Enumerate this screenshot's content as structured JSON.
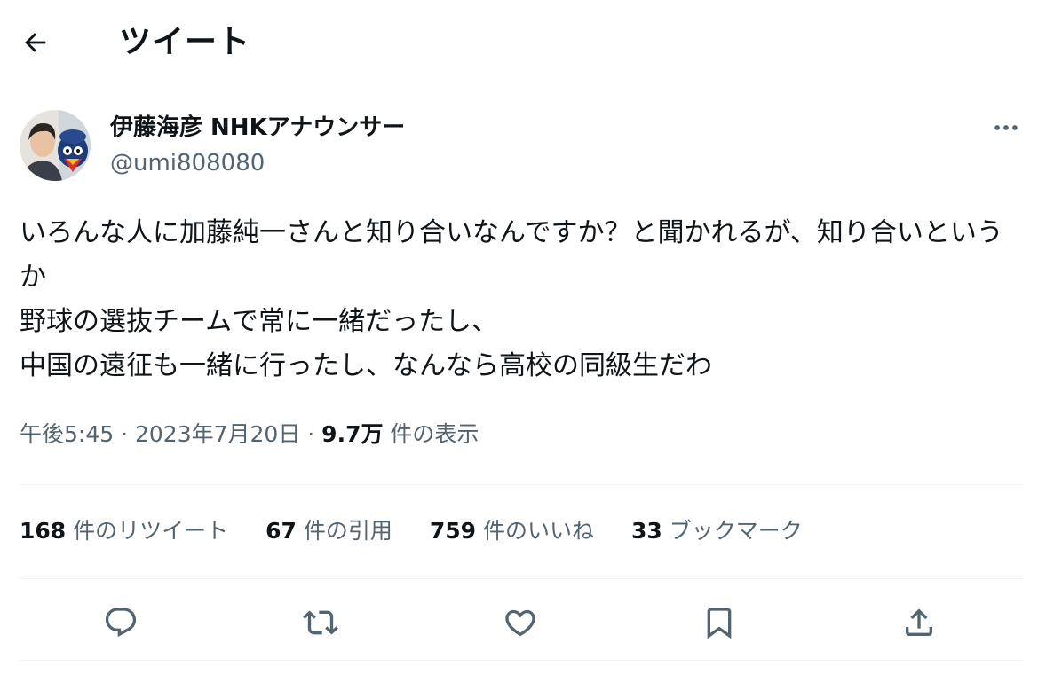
{
  "header": {
    "back_icon": "arrow-left-icon",
    "title": "ツイート"
  },
  "author": {
    "display_name": "伊藤海彦 NHKアナウンサー",
    "handle": "@umi808080",
    "more_icon": "more-horizontal-icon"
  },
  "tweet": {
    "text": "いろんな人に加藤純一さんと知り合いなんですか？と聞かれるが、知り合いというか\n野球の選抜チームで常に一緒だったし、\n中国の遠征も一緒に行ったし、なんなら高校の同級生だわ"
  },
  "meta": {
    "time": "午後5:45",
    "separator1": " · ",
    "date": "2023年7月20日",
    "separator2": " · ",
    "views_count": "9.7万",
    "views_label": " 件の表示"
  },
  "stats": {
    "retweets": {
      "count": "168",
      "label": " 件のリツイート"
    },
    "quotes": {
      "count": "67",
      "label": " 件の引用"
    },
    "likes": {
      "count": "759",
      "label": " 件のいいね"
    },
    "bookmarks": {
      "count": "33",
      "label": " ブックマーク"
    }
  },
  "actions": {
    "reply_icon": "reply-icon",
    "retweet_icon": "retweet-icon",
    "like_icon": "heart-icon",
    "bookmark_icon": "bookmark-icon",
    "share_icon": "share-icon"
  },
  "colors": {
    "text_primary": "#0f1419",
    "text_secondary": "#536471",
    "divider": "#eff3f4"
  }
}
